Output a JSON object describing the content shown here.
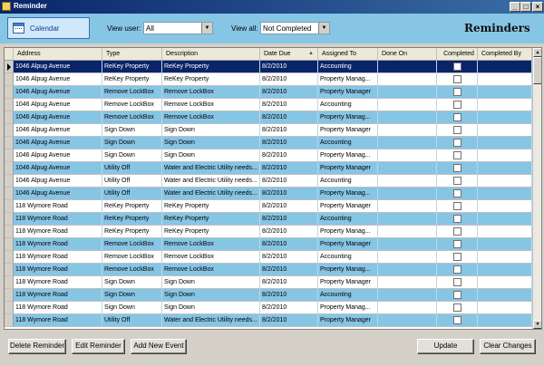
{
  "window": {
    "title": "Reminder"
  },
  "toolbar": {
    "calendar_label": "Calendar",
    "view_user_label": "View user:",
    "view_user_value": "All",
    "view_all_label": "View all:",
    "view_all_value": "Not Completed",
    "heading": "Reminders"
  },
  "grid": {
    "columns": [
      "Address",
      "Type",
      "Description",
      "Date Due",
      "Assigned To",
      "Done On",
      "Completed",
      "Completed By"
    ],
    "rows": [
      [
        "1046 Alpug Avenue",
        "ReKey Property",
        "ReKey Property",
        "8/2/2010",
        "Accounting",
        "",
        "",
        ""
      ],
      [
        "1046 Alpug Avenue",
        "ReKey Property",
        "ReKey Property",
        "8/2/2010",
        "Property Manag...",
        "",
        "",
        ""
      ],
      [
        "1046 Alpug Avenue",
        "Remove LockBox",
        "Remove LockBox",
        "8/2/2010",
        "Property Manager",
        "",
        "",
        ""
      ],
      [
        "1046 Alpug Avenue",
        "Remove LockBox",
        "Remove LockBox",
        "8/2/2010",
        "Accounting",
        "",
        "",
        ""
      ],
      [
        "1046 Alpug Avenue",
        "Remove LockBox",
        "Remove LockBox",
        "8/2/2010",
        "Property Manag...",
        "",
        "",
        ""
      ],
      [
        "1046 Alpug Avenue",
        "Sign Down",
        "Sign Down",
        "8/2/2010",
        "Property Manager",
        "",
        "",
        ""
      ],
      [
        "1046 Alpug Avenue",
        "Sign Down",
        "Sign Down",
        "8/2/2010",
        "Accounting",
        "",
        "",
        ""
      ],
      [
        "1046 Alpug Avenue",
        "Sign Down",
        "Sign Down",
        "8/2/2010",
        "Property Manag...",
        "",
        "",
        ""
      ],
      [
        "1046 Alpug Avenue",
        "Utility Off",
        "Water and Electric Utility needs...",
        "8/2/2010",
        "Property Manager",
        "",
        "",
        ""
      ],
      [
        "1046 Alpug Avenue",
        "Utility Off",
        "Water and Electric Utility needs...",
        "8/2/2010",
        "Accounting",
        "",
        "",
        ""
      ],
      [
        "1046 Alpug Avenue",
        "Utility Off",
        "Water and Electric Utility needs...",
        "8/2/2010",
        "Property Manag...",
        "",
        "",
        ""
      ],
      [
        "118 Wymore Road",
        "ReKey Property",
        "ReKey Property",
        "8/2/2010",
        "Property Manager",
        "",
        "",
        ""
      ],
      [
        "118 Wymore Road",
        "ReKey Property",
        "ReKey Property",
        "8/2/2010",
        "Accounting",
        "",
        "",
        ""
      ],
      [
        "118 Wymore Road",
        "ReKey Property",
        "ReKey Property",
        "8/2/2010",
        "Property Manag...",
        "",
        "",
        ""
      ],
      [
        "118 Wymore Road",
        "Remove LockBox",
        "Remove LockBox",
        "8/2/2010",
        "Property Manager",
        "",
        "",
        ""
      ],
      [
        "118 Wymore Road",
        "Remove LockBox",
        "Remove LockBox",
        "8/2/2010",
        "Accounting",
        "",
        "",
        ""
      ],
      [
        "118 Wymore Road",
        "Remove LockBox",
        "Remove LockBox",
        "8/2/2010",
        "Property Manag...",
        "",
        "",
        ""
      ],
      [
        "118 Wymore Road",
        "Sign Down",
        "Sign Down",
        "8/2/2010",
        "Property Manager",
        "",
        "",
        ""
      ],
      [
        "118 Wymore Road",
        "Sign Down",
        "Sign Down",
        "8/2/2010",
        "Accounting",
        "",
        "",
        ""
      ],
      [
        "118 Wymore Road",
        "Sign Down",
        "Sign Down",
        "8/2/2010",
        "Property Manag...",
        "",
        "",
        ""
      ],
      [
        "118 Wymore Road",
        "Utility Off",
        "Water and Electric Utility needs...",
        "8/2/2010",
        "Property Manager",
        "",
        "",
        ""
      ]
    ]
  },
  "buttons": {
    "delete": "Delete Reminder",
    "edit": "Edit Reminder",
    "add": "Add New Event",
    "update": "Update",
    "clear": "Clear Changes"
  },
  "colors": {
    "alt_row": "#87c5e5",
    "selection": "#0a246a",
    "toolbar": "#87c5e5"
  }
}
